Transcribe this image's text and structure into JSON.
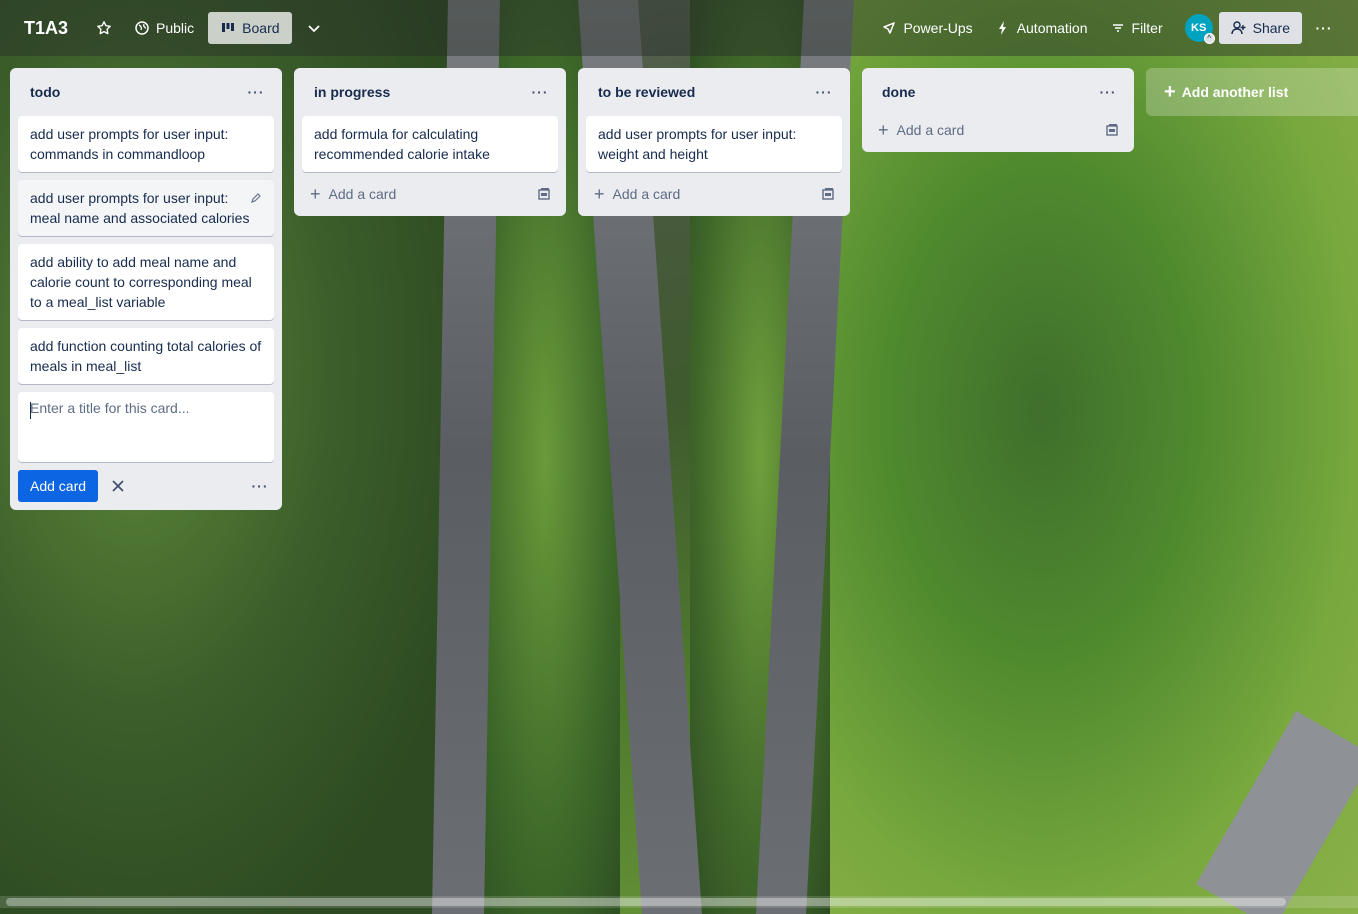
{
  "header": {
    "board_title": "T1A3",
    "visibility_label": "Public",
    "view_label": "Board",
    "powerups_label": "Power-Ups",
    "automation_label": "Automation",
    "filter_label": "Filter",
    "avatar_initials": "KS",
    "share_label": "Share"
  },
  "lists": [
    {
      "title": "todo",
      "cards": [
        "add user prompts for user input: commands in commandloop",
        "add user prompts for user input: meal name and associated calories",
        "add ability to add meal name and calorie count to corresponding meal to a meal_list variable",
        "add function counting total calories of meals in meal_list"
      ],
      "composer_placeholder": "Enter a title for this card...",
      "add_card_button": "Add card"
    },
    {
      "title": "in progress",
      "cards": [
        "add formula for calculating recommended calorie intake"
      ],
      "add_card_label": "Add a card"
    },
    {
      "title": "to be reviewed",
      "cards": [
        "add user prompts for user input: weight and height"
      ],
      "add_card_label": "Add a card"
    },
    {
      "title": "done",
      "cards": [],
      "add_card_label": "Add a card"
    }
  ],
  "add_list_label": "Add another list",
  "colors": {
    "list_bg": "#ebecf0",
    "primary_button": "#0c66e4",
    "avatar": "#00a3bf"
  }
}
